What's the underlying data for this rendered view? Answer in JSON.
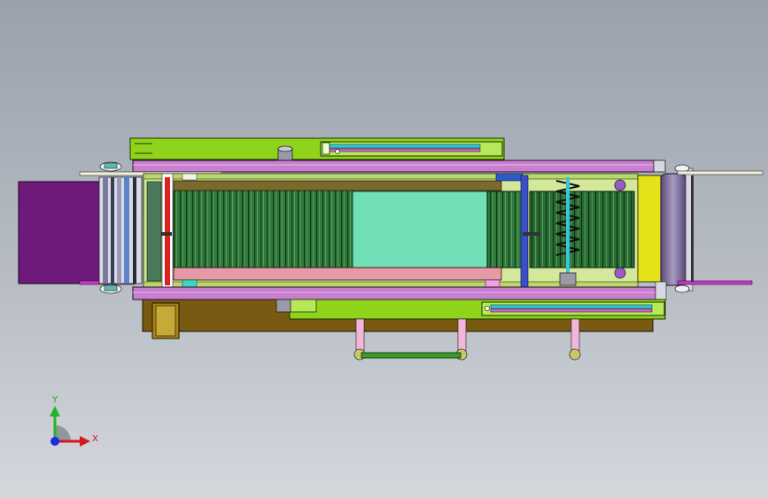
{
  "triad": {
    "x_label": "X",
    "y_label": "Y"
  },
  "colors": {
    "background_top": "#9aa1ab",
    "background_bottom": "#d4d7dc",
    "frame_green": "#8fd41a",
    "rail_violet": "#c87fd0",
    "belt_green": "#2f7a3a",
    "panel_mint": "#72e0b6",
    "hopper_purple": "#6e1a7a",
    "roller_yellow": "#e6e21a",
    "base_brown": "#7a5a12",
    "cylinder_cyan": "#36c8d8",
    "axis_x": "#d81818",
    "axis_y": "#26b426",
    "axis_z": "#1a2ae6"
  }
}
